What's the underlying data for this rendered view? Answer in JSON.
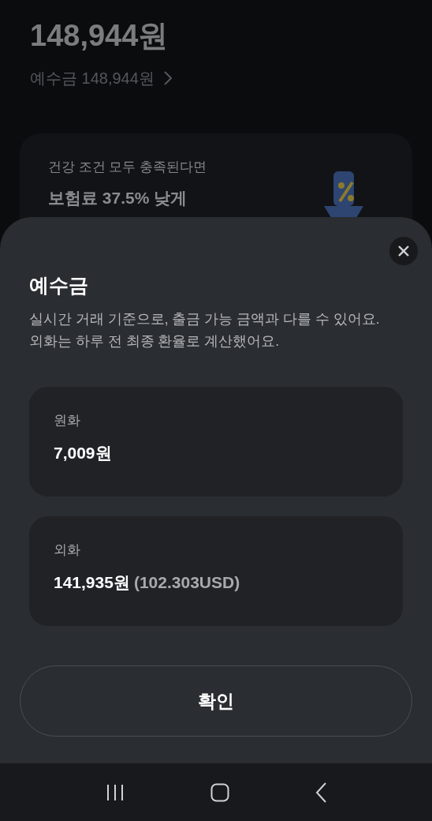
{
  "background": {
    "total": "148,944원",
    "deposit_link": "예수금 148,944원",
    "banner": {
      "subtitle": "건강 조건 모두 충족된다면",
      "title": "보험료 37.5% 낮게",
      "kind": "picture"
    }
  },
  "sheet": {
    "title": "예수금",
    "description": [
      "실시간 거래 기준으로, 출금 가능 금액과 다를 수 있어요.",
      "외화는 하루 전 최종 환율로 계산했어요."
    ],
    "items": [
      {
        "label": "원화",
        "value": "7,009원"
      },
      {
        "label": "외화",
        "value": "141,935원",
        "secondary": "(102.303USD)"
      }
    ],
    "confirm": "확인"
  }
}
